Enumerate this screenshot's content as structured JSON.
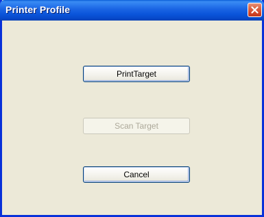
{
  "window": {
    "title": "Printer Profile"
  },
  "buttons": {
    "print_target": "PrintTarget",
    "scan_target": "Scan Target",
    "cancel": "Cancel"
  },
  "colors": {
    "titlebar": "#0a54d9",
    "close_button": "#d4472a",
    "dialog_background": "#ece9d8",
    "disabled_text": "#aca899"
  },
  "icons": {
    "close": "close-icon"
  }
}
